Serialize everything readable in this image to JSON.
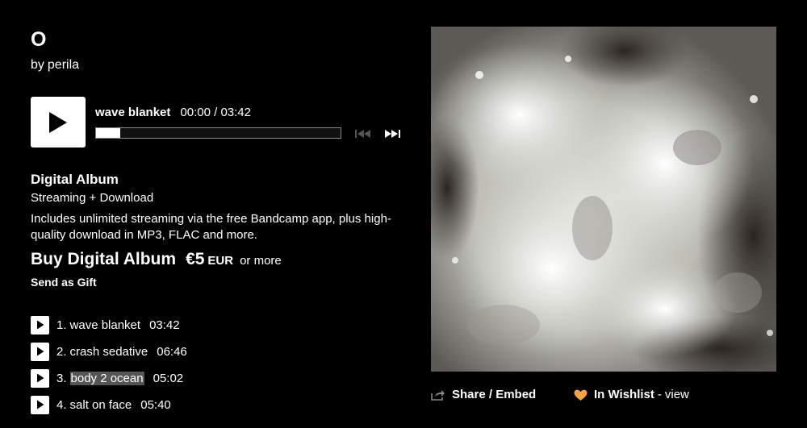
{
  "album": {
    "title": "O",
    "by_prefix": "by",
    "artist": "perila"
  },
  "player": {
    "track_title": "wave blanket",
    "time_current": "00:00",
    "time_separator": "/",
    "time_total": "03:42",
    "progress": 0
  },
  "purchase": {
    "format_label": "Digital Album",
    "format_sub": "Streaming + Download",
    "description": "Includes unlimited streaming via the free Bandcamp app, plus high-quality download in MP3, FLAC and more.",
    "buy_label": "Buy Digital Album",
    "price": "€5",
    "currency": "EUR",
    "or_more": "or more",
    "gift_label": "Send as Gift"
  },
  "tracks": [
    {
      "number": "1.",
      "name": "wave blanket",
      "duration": "03:42"
    },
    {
      "number": "2.",
      "name": "crash sedative",
      "duration": "06:46"
    },
    {
      "number": "3.",
      "name": "body 2 ocean",
      "duration": "05:02"
    },
    {
      "number": "4.",
      "name": "salt on face",
      "duration": "05:40"
    }
  ],
  "actions": {
    "share_label": "Share / Embed",
    "wishlist_label": "In Wishlist",
    "wishlist_separator": "-",
    "wishlist_view": "view"
  },
  "icons": {
    "play": "play-icon",
    "prev": "skip-previous-icon",
    "next": "skip-next-icon",
    "share": "share-icon",
    "wishlist": "heart-icon"
  },
  "colors": {
    "background": "#000000",
    "text": "#ffffff",
    "wishlist_heart": "#f5a33a",
    "disabled_control": "#555555",
    "highlight": "#555555"
  }
}
